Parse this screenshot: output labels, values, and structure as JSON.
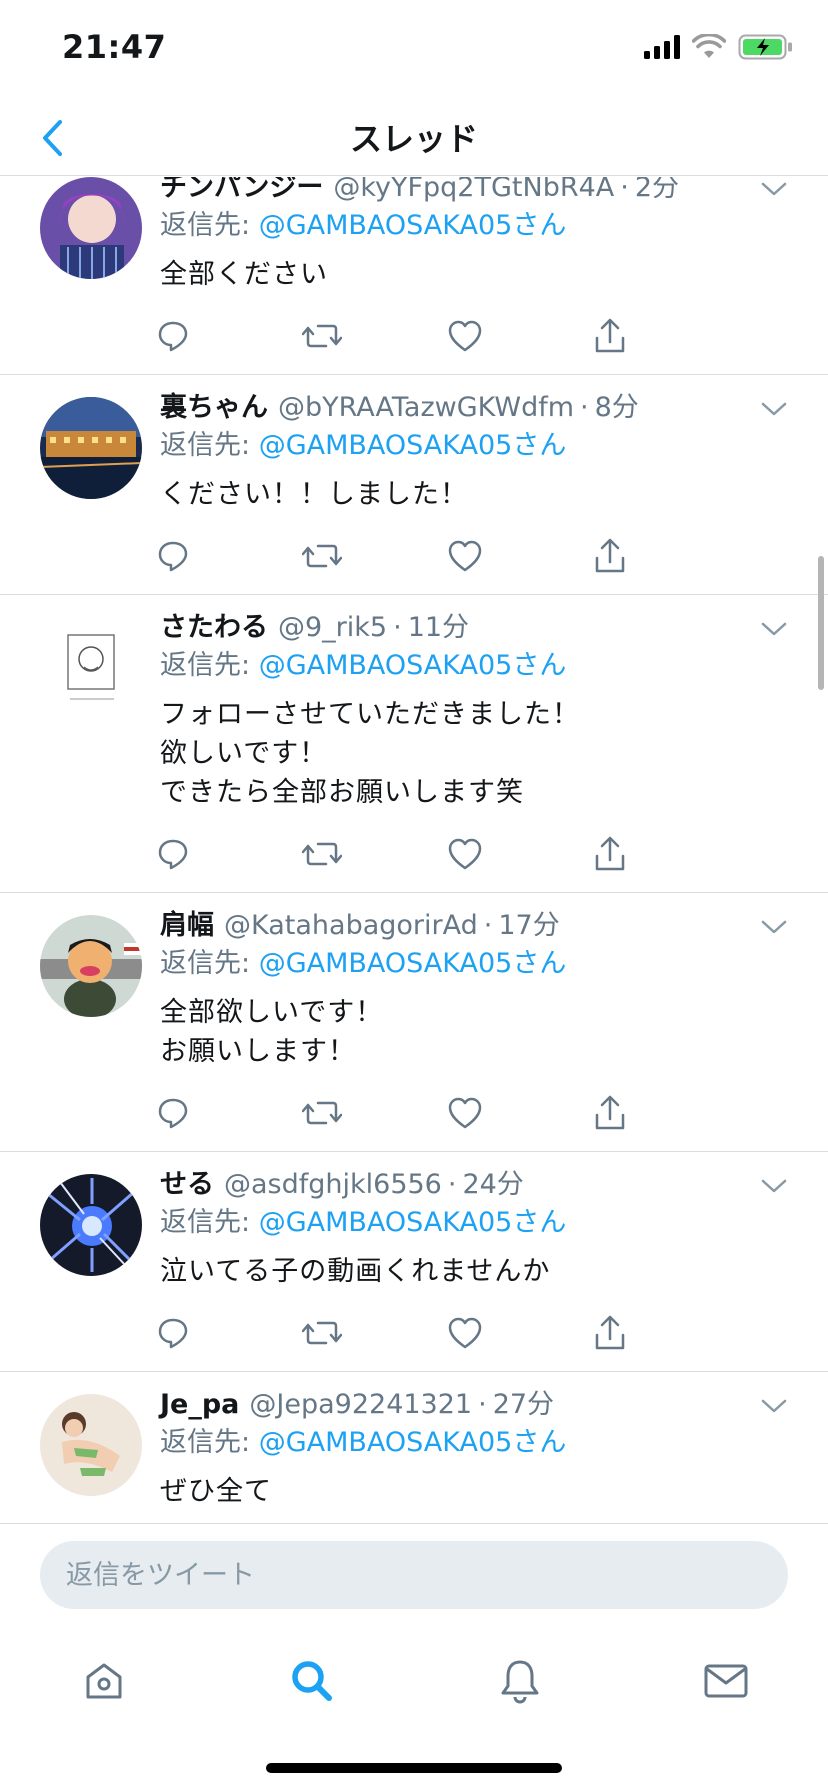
{
  "status_bar": {
    "time": "21:47",
    "icons": [
      "cellular-signal-icon",
      "wifi-icon",
      "battery-charging-icon"
    ]
  },
  "nav": {
    "title": "スレッド",
    "back_icon": "chevron-left-icon"
  },
  "tweets": [
    {
      "name": "チンパンジー",
      "handle": "@kyYFpq2TGtNbR4A",
      "dot": "·",
      "time": "2分",
      "reply_prefix": "返信先: ",
      "reply_to": "@GAMBAOSAKA05さん",
      "text": "全部ください"
    },
    {
      "name": "裏ちゃん",
      "handle": "@bYRAATazwGKWdfm",
      "dot": "·",
      "time": "8分",
      "reply_prefix": "返信先: ",
      "reply_to": "@GAMBAOSAKA05さん",
      "text": "ください！！しました！"
    },
    {
      "name": "さたわる",
      "handle": "@9_rik5",
      "dot": "·",
      "time": "11分",
      "reply_prefix": "返信先: ",
      "reply_to": "@GAMBAOSAKA05さん",
      "text": "フォローさせていただきました！\n欲しいです！\nできたら全部お願いします笑"
    },
    {
      "name": "肩幅",
      "handle": "@KatahabagorirAd",
      "dot": "·",
      "time": "17分",
      "reply_prefix": "返信先: ",
      "reply_to": "@GAMBAOSAKA05さん",
      "text": "全部欲しいです！\nお願いします！"
    },
    {
      "name": "せる",
      "handle": "@asdfghjkl6556",
      "dot": "·",
      "time": "24分",
      "reply_prefix": "返信先: ",
      "reply_to": "@GAMBAOSAKA05さん",
      "text": "泣いてる子の動画くれませんか"
    },
    {
      "name": "Je_pa",
      "handle": "@Jepa92241321",
      "dot": "·",
      "time": "27分",
      "reply_prefix": "返信先: ",
      "reply_to": "@GAMBAOSAKA05さん",
      "text": "ぜひ全て"
    }
  ],
  "tweet_actions": [
    "reply-icon",
    "retweet-icon",
    "like-icon",
    "share-icon"
  ],
  "composer": {
    "placeholder": "返信をツイート"
  },
  "tab_bar": {
    "tabs": [
      "home-icon",
      "search-icon",
      "notifications-icon",
      "messages-icon"
    ],
    "active": "search-icon"
  },
  "colors": {
    "accent": "#1da1f2",
    "text_primary": "#14171a",
    "text_secondary": "#657786",
    "divider": "#d8dde1",
    "input_bg": "#e6ecf0",
    "battery": "#4cd964"
  }
}
